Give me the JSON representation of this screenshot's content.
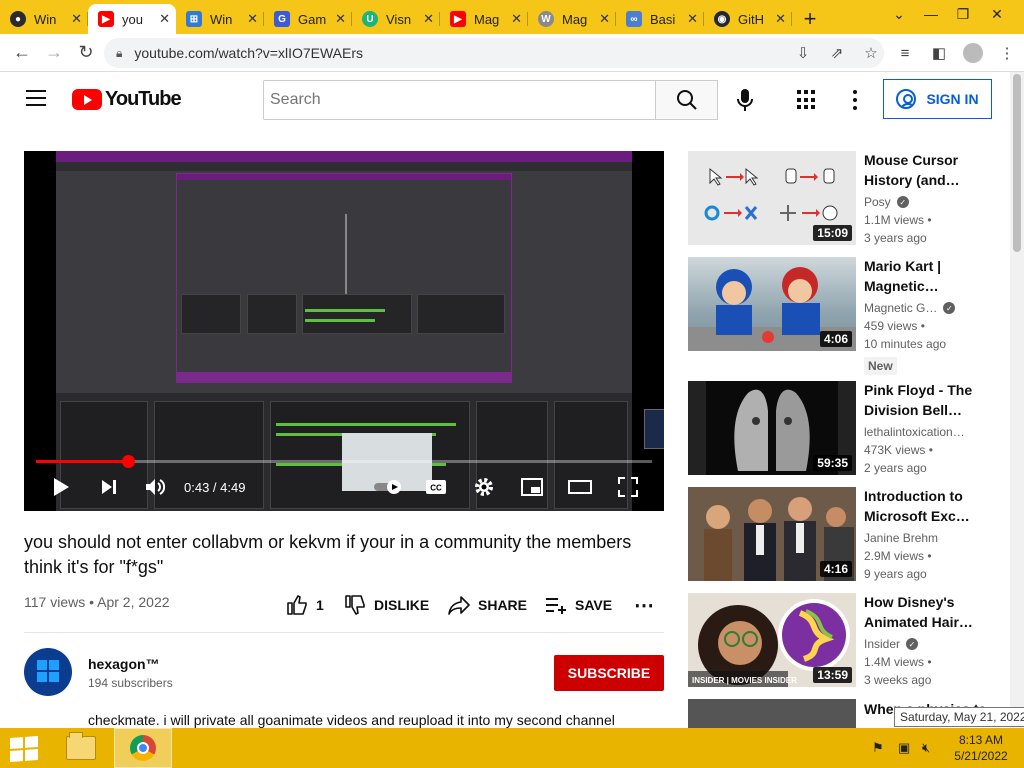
{
  "browser": {
    "tabs": [
      {
        "label": "Win",
        "favicon": "obs-icon",
        "color": "#2b2b2b"
      },
      {
        "label": "you",
        "favicon": "youtube-icon",
        "color": "#ff0000",
        "active": true
      },
      {
        "label": "Win",
        "favicon": "windows-icon",
        "color": "#2f7bd6"
      },
      {
        "label": "Gam",
        "favicon": "g-icon",
        "color": "#3b5bdb"
      },
      {
        "label": "Visn",
        "favicon": "u-icon",
        "color": "#1bb57a"
      },
      {
        "label": "Mag",
        "favicon": "youtube-icon",
        "color": "#ff0000"
      },
      {
        "label": "Mag",
        "favicon": "wiki-icon",
        "color": "#8a8a8a"
      },
      {
        "label": "Basi",
        "favicon": "link-icon",
        "color": "#4a7fd1"
      },
      {
        "label": "GitH",
        "favicon": "github-icon",
        "color": "#24292f"
      }
    ],
    "url": "youtube.com/watch?v=xlIO7EWAErs"
  },
  "header": {
    "logo_text": "YouTube",
    "search_placeholder": "Search",
    "signin_label": "SIGN IN"
  },
  "player": {
    "time": "0:43 / 4:49",
    "progress": 0.149
  },
  "video": {
    "title": "you should not enter collabvm or kekvm if your in a community the members think it's for \"f*gs\"",
    "meta": "117 views • Apr 2, 2022",
    "like_count": "1",
    "dislike_label": "DISLIKE",
    "share_label": "SHARE",
    "save_label": "SAVE"
  },
  "channel": {
    "name": "hexagon™",
    "subscribers": "194 subscribers",
    "subscribe_label": "SUBSCRIBE",
    "description": "checkmate. i will private all goanimate videos and reupload it into my second channel"
  },
  "recommendations": [
    {
      "title": "Mouse Cursor History (and…",
      "channel": "Posy",
      "verified": true,
      "views": "1.1M views •",
      "age": "3 years ago",
      "duration": "15:09"
    },
    {
      "title": "Mario Kart | Magnetic…",
      "channel": "Magnetic G…",
      "verified": true,
      "views": "459 views •",
      "age": "10 minutes ago",
      "duration": "4:06",
      "badge": "New"
    },
    {
      "title": "Pink Floyd - The Division Bell…",
      "channel": "lethalintoxication…",
      "verified": false,
      "views": "473K views •",
      "age": "2 years ago",
      "duration": "59:35"
    },
    {
      "title": "Introduction to Microsoft Exc…",
      "channel": "Janine Brehm",
      "verified": false,
      "views": "2.9M views •",
      "age": "9 years ago",
      "duration": "4:16"
    },
    {
      "title": "How Disney's Animated Hair…",
      "channel": "Insider",
      "verified": true,
      "views": "1.4M views •",
      "age": "3 weeks ago",
      "duration": "13:59"
    },
    {
      "title": "When a physics te…"
    }
  ],
  "tooltip": "Saturday, May 21, 2022",
  "taskbar": {
    "time": "8:13 AM",
    "date": "5/21/2022"
  },
  "colors": {
    "tabstrip": "#f5c518",
    "taskbar": "#e8b400",
    "youtube_red": "#ff0000",
    "subscribe_red": "#cc0000",
    "link_blue": "#065fd4"
  }
}
